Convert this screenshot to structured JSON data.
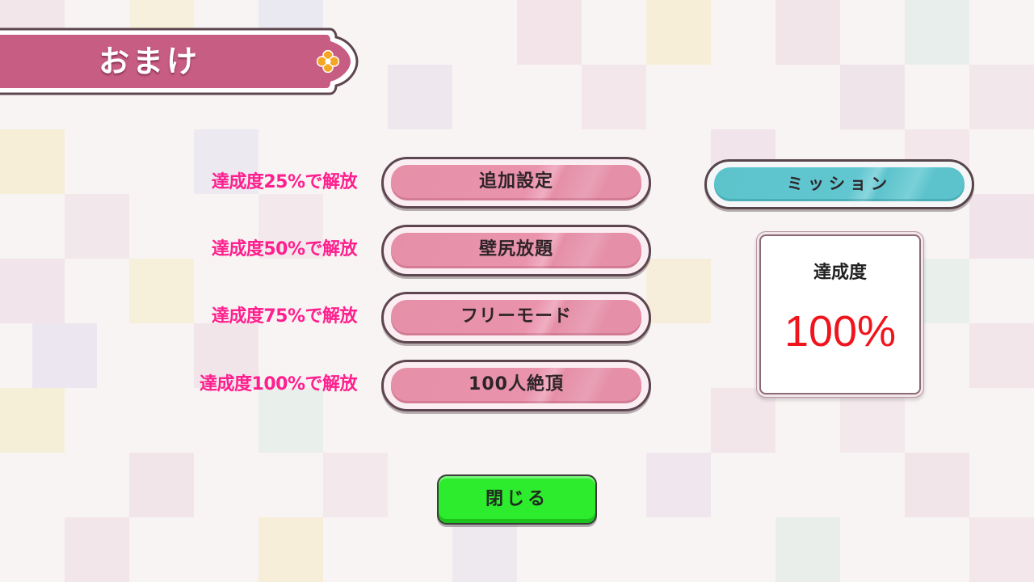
{
  "header": {
    "title": "おまけ"
  },
  "unlocks": [
    {
      "condition": "達成度25%で解放",
      "button_label": "追加設定"
    },
    {
      "condition": "達成度50%で解放",
      "button_label": "壁尻放題"
    },
    {
      "condition": "達成度75%で解放",
      "button_label": "フリーモード"
    },
    {
      "condition": "達成度100%で解放",
      "button_label": "100人絶頂"
    }
  ],
  "mission": {
    "label": "ミッション"
  },
  "achievement": {
    "title": "達成度",
    "value": "100%"
  },
  "close": {
    "label": "閉じる"
  },
  "colors": {
    "banner": "#c75d82",
    "unlock_text": "#ff1f8e",
    "pink_button": "#e58fa8",
    "teal_button": "#5cc3cc",
    "achievement_value": "#f0141c",
    "close_button": "#2dec2d"
  },
  "icons": {
    "banner_ornament": "flower-icon"
  }
}
